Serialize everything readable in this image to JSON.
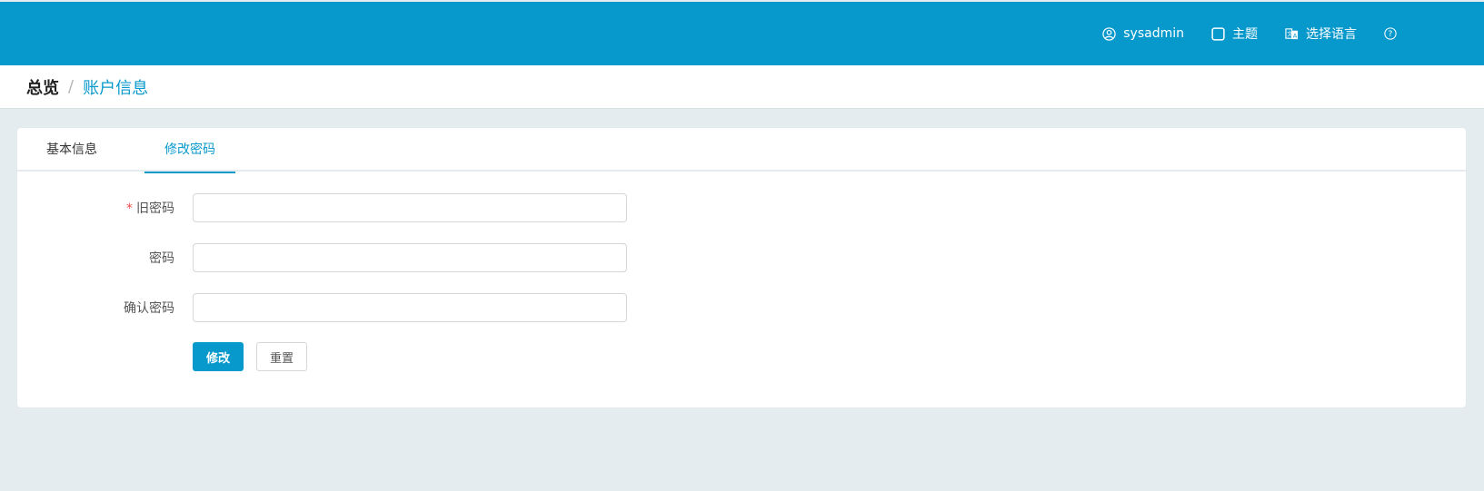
{
  "header": {
    "username": "sysadmin",
    "theme_label": "主题",
    "language_label": "选择语言",
    "help_label": "?"
  },
  "breadcrumb": {
    "home": "总览",
    "separator": "/",
    "current": "账户信息"
  },
  "tabs": [
    {
      "label": "基本信息",
      "active": false
    },
    {
      "label": "修改密码",
      "active": true
    }
  ],
  "form": {
    "old_password": {
      "label": "旧密码",
      "required": true,
      "value": ""
    },
    "password": {
      "label": "密码",
      "value": ""
    },
    "confirm_password": {
      "label": "确认密码",
      "value": ""
    },
    "submit_label": "修改",
    "reset_label": "重置"
  },
  "colors": {
    "accent": "#0899cc",
    "background": "#e4ecef",
    "required": "#ee4b4b"
  }
}
